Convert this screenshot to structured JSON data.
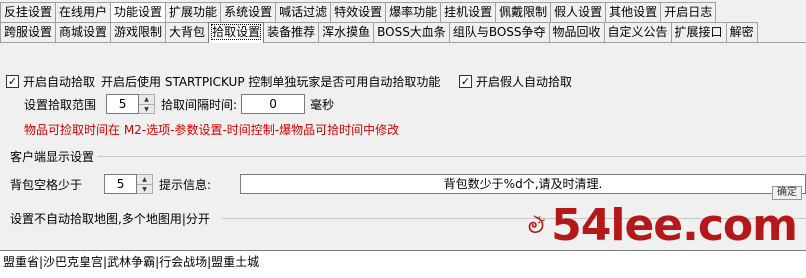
{
  "tabs_row1": [
    "反挂设置",
    "在线用户",
    "功能设置",
    "扩展功能",
    "系统设置",
    "喊话过滤",
    "特效设置",
    "爆率功能",
    "挂机设置",
    "佩戴限制",
    "假人设置",
    "其他设置",
    "开启日志"
  ],
  "tabs_row2": [
    "跨服设置",
    "商城设置",
    "游戏限制",
    "大背包",
    "拾取设置",
    "装备推荐",
    "浑水摸鱼",
    "BOSS大血条",
    "组队与BOSS争夺",
    "物品回收",
    "自定义公告",
    "扩展接口",
    "解密"
  ],
  "auto_pickup": {
    "check_mark": "✓",
    "checkbox_label": "开启自动拾取",
    "hint": "开启后使用 STARTPICKUP 控制单独玩家是否可用自动拾取功能",
    "fake_checkbox_label": "开启假人自动拾取",
    "range_label": "设置拾取范围",
    "range_value": "5",
    "interval_label": "拾取间隔时间:",
    "interval_value": "0",
    "interval_unit": "毫秒",
    "note": "物品可捡取时间在 M2-选项-参数设置-时间控制-爆物品可拾时间中修改"
  },
  "client_display": {
    "group_title": "客户端显示设置",
    "bag_label": "背包空格少于",
    "bag_value": "5",
    "tip_label": "提示信息:",
    "tip_value": "背包数少于%d个,请及时清理."
  },
  "no_pickup_maps": {
    "group_title": "设置不自动拾取地图,多个地图用|分开",
    "value": "盟重省|沙巴克皇宫|武林争霸|行会战场|盟重土城"
  },
  "watermark": {
    "text": "54lee.com",
    "side_label": "确定"
  }
}
